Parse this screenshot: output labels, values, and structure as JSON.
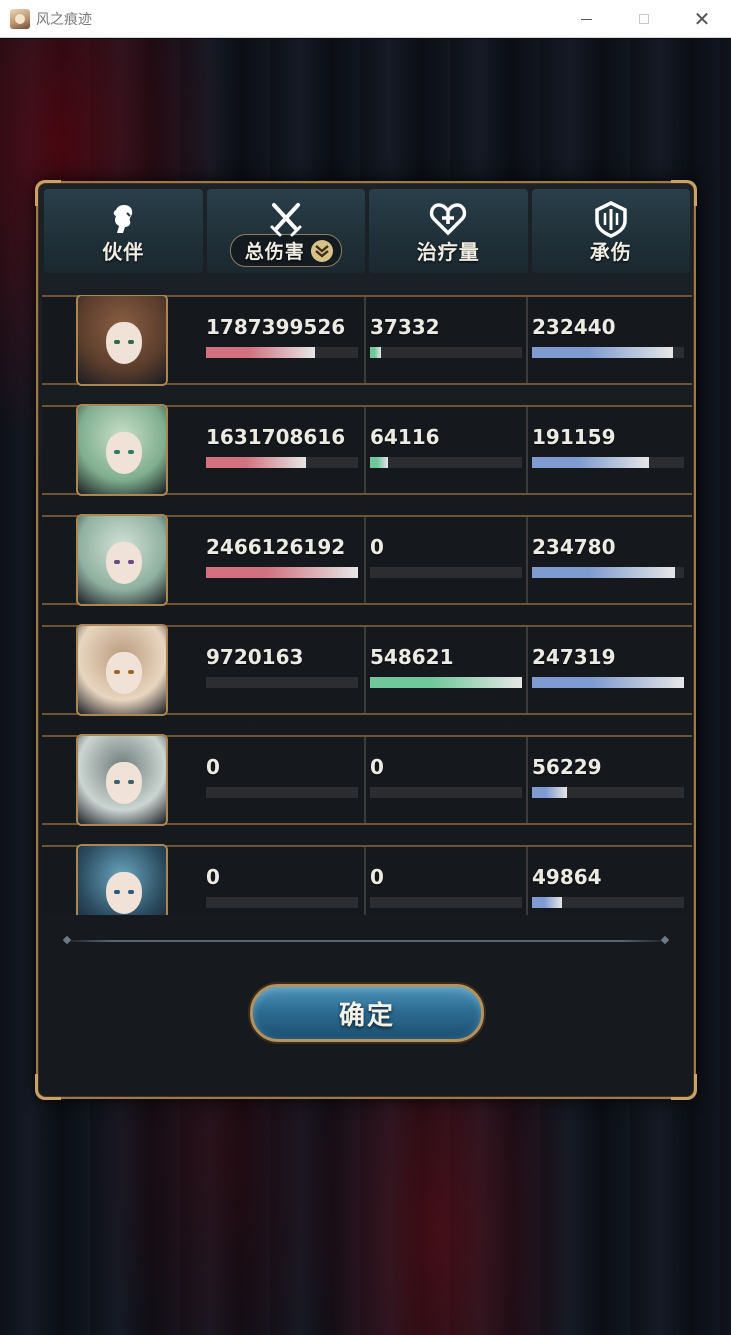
{
  "window": {
    "title": "风之痕迹",
    "minimize_symbol": "—",
    "maximize_symbol": "☐",
    "close_symbol": "✕"
  },
  "tabs": [
    {
      "label": "伙伴",
      "icon": "partner-icon"
    },
    {
      "label": "总伤害",
      "icon": "crossed-swords-icon",
      "dropdown": true
    },
    {
      "label": "治疗量",
      "icon": "heart-plus-icon"
    },
    {
      "label": "承伤",
      "icon": "shield-icon"
    }
  ],
  "colors": {
    "damage_bar": "#d2727f",
    "heal_bar": "#6fc79a",
    "tank_bar": "#7f9bd0",
    "frame_gold": "#9c7a48",
    "button_blue": "#2d6d92"
  },
  "rows": [
    {
      "damage": "1787399526",
      "damage_pct": 72,
      "heal": "37332",
      "heal_pct": 7,
      "tank": "232440",
      "tank_pct": 93
    },
    {
      "damage": "1631708616",
      "damage_pct": 66,
      "heal": "64116",
      "heal_pct": 12,
      "tank": "191159",
      "tank_pct": 77
    },
    {
      "damage": "2466126192",
      "damage_pct": 100,
      "heal": "0",
      "heal_pct": 0,
      "tank": "234780",
      "tank_pct": 94
    },
    {
      "damage": "9720163",
      "damage_pct": 0,
      "heal": "548621",
      "heal_pct": 100,
      "tank": "247319",
      "tank_pct": 100
    },
    {
      "damage": "0",
      "damage_pct": 0,
      "heal": "0",
      "heal_pct": 0,
      "tank": "56229",
      "tank_pct": 23
    },
    {
      "damage": "0",
      "damage_pct": 0,
      "heal": "0",
      "heal_pct": 0,
      "tank": "49864",
      "tank_pct": 20
    }
  ],
  "confirm_button": {
    "label": "确定"
  }
}
